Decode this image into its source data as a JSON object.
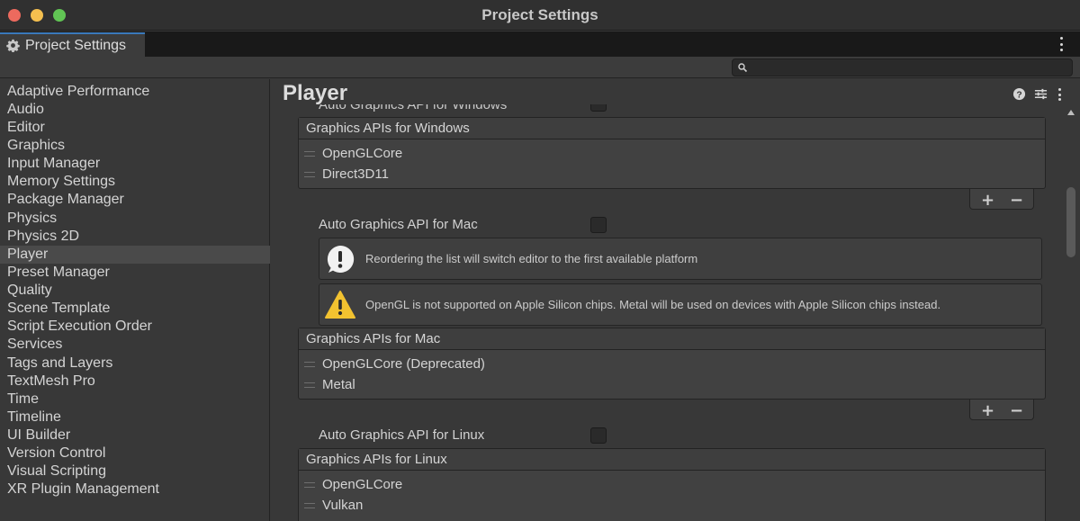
{
  "window": {
    "title": "Project Settings"
  },
  "tab": {
    "label": "Project Settings",
    "icon": "gear-icon"
  },
  "search": {
    "placeholder": "",
    "value": ""
  },
  "sidebar": {
    "items": [
      {
        "label": "Adaptive Performance"
      },
      {
        "label": "Audio"
      },
      {
        "label": "Editor"
      },
      {
        "label": "Graphics"
      },
      {
        "label": "Input Manager"
      },
      {
        "label": "Memory Settings"
      },
      {
        "label": "Package Manager"
      },
      {
        "label": "Physics"
      },
      {
        "label": "Physics 2D"
      },
      {
        "label": "Player",
        "selected": true
      },
      {
        "label": "Preset Manager"
      },
      {
        "label": "Quality"
      },
      {
        "label": "Scene Template"
      },
      {
        "label": "Script Execution Order"
      },
      {
        "label": "Services"
      },
      {
        "label": "Tags and Layers"
      },
      {
        "label": "TextMesh Pro"
      },
      {
        "label": "Time"
      },
      {
        "label": "Timeline"
      },
      {
        "label": "UI Builder"
      },
      {
        "label": "Version Control"
      },
      {
        "label": "Visual Scripting"
      },
      {
        "label": "XR Plugin Management"
      }
    ]
  },
  "main": {
    "title": "Player",
    "partial_row_label": "Auto Graphics API  for Windows",
    "windows_list": {
      "header": "Graphics APIs for Windows",
      "items": [
        "OpenGLCore",
        "Direct3D11"
      ]
    },
    "mac_toggle_label": "Auto Graphics API  for Mac",
    "info_message": "Reordering the list will switch editor to the first available platform",
    "warning_message": "OpenGL is not supported on Apple Silicon chips. Metal will be used on devices with Apple Silicon chips instead.",
    "mac_list": {
      "header": "Graphics APIs for Mac",
      "items": [
        "OpenGLCore (Deprecated)",
        "Metal"
      ]
    },
    "linux_toggle_label": "Auto Graphics API  for Linux",
    "linux_list": {
      "header": "Graphics APIs for Linux",
      "items": [
        "OpenGLCore",
        "Vulkan"
      ]
    },
    "add_symbol": "+",
    "remove_symbol": "−"
  },
  "colors": {
    "accent": "#3a79bb",
    "warning": "#f2c230",
    "close": "#ed6a5e",
    "minimize": "#f4bf4f",
    "maximize": "#61c554"
  }
}
